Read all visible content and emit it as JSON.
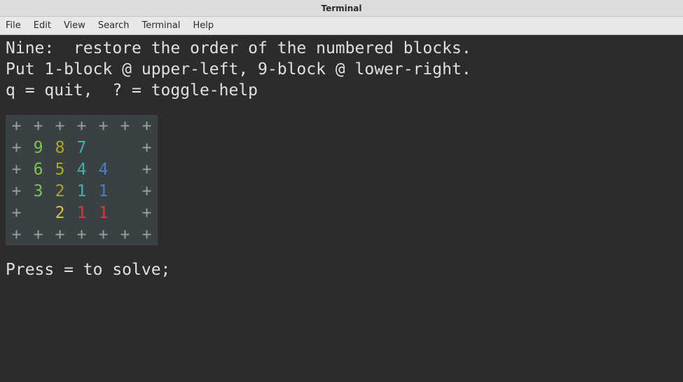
{
  "window": {
    "title": "Terminal"
  },
  "menu": {
    "items": [
      "File",
      "Edit",
      "View",
      "Search",
      "Terminal",
      "Help"
    ]
  },
  "text": {
    "line1": "Nine:  restore the order of the numbered blocks.",
    "line2": "Put 1-block @ upper-left, 9-block @ lower-right.",
    "line3": "q = quit,  ? = toggle-help",
    "line4": "Press = to solve;"
  },
  "grid": {
    "rows": [
      [
        {
          "v": "+",
          "c": "border"
        },
        {
          "v": "+",
          "c": "border"
        },
        {
          "v": "+",
          "c": "border"
        },
        {
          "v": "+",
          "c": "border"
        },
        {
          "v": "+",
          "c": "border"
        },
        {
          "v": "+",
          "c": "border"
        },
        {
          "v": "+",
          "c": "border"
        }
      ],
      [
        {
          "v": "+",
          "c": "border"
        },
        {
          "v": "9",
          "c": "c-green"
        },
        {
          "v": "8",
          "c": "c-olive"
        },
        {
          "v": "7",
          "c": "c-teal"
        },
        {
          "v": "",
          "c": ""
        },
        {
          "v": "",
          "c": ""
        },
        {
          "v": "+",
          "c": "border"
        }
      ],
      [
        {
          "v": "+",
          "c": "border"
        },
        {
          "v": "6",
          "c": "c-green"
        },
        {
          "v": "5",
          "c": "c-olive"
        },
        {
          "v": "4",
          "c": "c-teal"
        },
        {
          "v": "4",
          "c": "c-blue"
        },
        {
          "v": "",
          "c": ""
        },
        {
          "v": "+",
          "c": "border"
        }
      ],
      [
        {
          "v": "+",
          "c": "border"
        },
        {
          "v": "3",
          "c": "c-green"
        },
        {
          "v": "2",
          "c": "c-olive"
        },
        {
          "v": "1",
          "c": "c-teal"
        },
        {
          "v": "1",
          "c": "c-blue"
        },
        {
          "v": "",
          "c": ""
        },
        {
          "v": "+",
          "c": "border"
        }
      ],
      [
        {
          "v": "+",
          "c": "border"
        },
        {
          "v": "",
          "c": ""
        },
        {
          "v": "2",
          "c": "c-yellow"
        },
        {
          "v": "1",
          "c": "c-red"
        },
        {
          "v": "1",
          "c": "c-red"
        },
        {
          "v": "",
          "c": ""
        },
        {
          "v": "+",
          "c": "border"
        }
      ],
      [
        {
          "v": "+",
          "c": "border"
        },
        {
          "v": "+",
          "c": "border"
        },
        {
          "v": "+",
          "c": "border"
        },
        {
          "v": "+",
          "c": "border"
        },
        {
          "v": "+",
          "c": "border"
        },
        {
          "v": "+",
          "c": "border"
        },
        {
          "v": "+",
          "c": "border"
        }
      ]
    ]
  }
}
